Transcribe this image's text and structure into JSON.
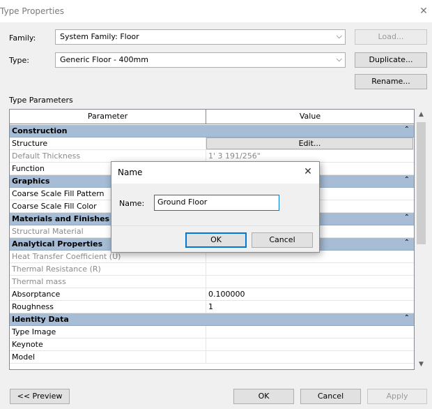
{
  "window": {
    "title": "Type Properties"
  },
  "family": {
    "label": "Family:",
    "value": "System Family: Floor"
  },
  "type": {
    "label": "Type:",
    "value": "Generic Floor - 400mm"
  },
  "buttons": {
    "load": "Load...",
    "duplicate": "Duplicate...",
    "rename": "Rename..."
  },
  "params": {
    "section_label": "Type Parameters",
    "col_parameter": "Parameter",
    "col_value": "Value",
    "rows": [
      {
        "kind": "group",
        "name": "Construction"
      },
      {
        "kind": "row",
        "name": "Structure",
        "value": "Edit...",
        "button": true
      },
      {
        "kind": "row",
        "name": "Default Thickness",
        "value": "1'  3 191/256\"",
        "disabled": true
      },
      {
        "kind": "row",
        "name": "Function",
        "value": ""
      },
      {
        "kind": "group",
        "name": "Graphics"
      },
      {
        "kind": "row",
        "name": "Coarse Scale Fill Pattern",
        "value": ""
      },
      {
        "kind": "row",
        "name": "Coarse Scale Fill Color",
        "value": ""
      },
      {
        "kind": "group",
        "name": "Materials and Finishes"
      },
      {
        "kind": "row",
        "name": "Structural Material",
        "value": "",
        "disabled": true
      },
      {
        "kind": "group",
        "name": "Analytical Properties"
      },
      {
        "kind": "row",
        "name": "Heat Transfer Coefficient (U)",
        "value": "",
        "disabled": true
      },
      {
        "kind": "row",
        "name": "Thermal Resistance (R)",
        "value": "",
        "disabled": true
      },
      {
        "kind": "row",
        "name": "Thermal mass",
        "value": "",
        "disabled": true
      },
      {
        "kind": "row",
        "name": "Absorptance",
        "value": "0.100000"
      },
      {
        "kind": "row",
        "name": "Roughness",
        "value": "1"
      },
      {
        "kind": "group",
        "name": "Identity Data"
      },
      {
        "kind": "row",
        "name": "Type Image",
        "value": ""
      },
      {
        "kind": "row",
        "name": "Keynote",
        "value": ""
      },
      {
        "kind": "row",
        "name": "Model",
        "value": ""
      }
    ]
  },
  "footer": {
    "preview": "<< Preview",
    "ok": "OK",
    "cancel": "Cancel",
    "apply": "Apply"
  },
  "dialog": {
    "title": "Name",
    "name_label": "Name:",
    "name_value": "Ground Floor",
    "ok": "OK",
    "cancel": "Cancel"
  }
}
